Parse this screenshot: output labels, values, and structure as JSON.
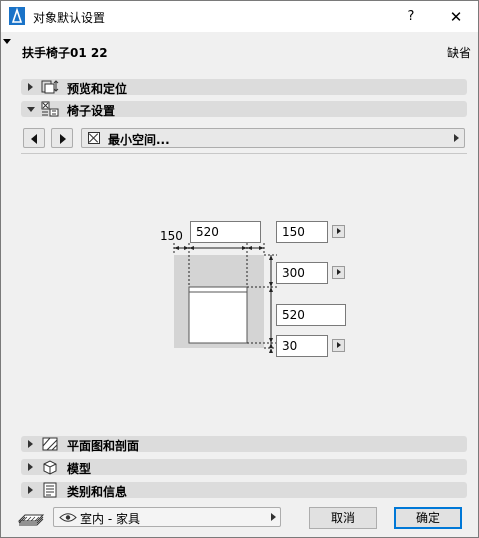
{
  "window": {
    "title": "对象默认设置",
    "help_label": "?",
    "close_label": "✕"
  },
  "header": {
    "object_name": "扶手椅子01 22",
    "default_label": "缺省"
  },
  "sections": {
    "preview": "预览和定位",
    "chair_settings": "椅子设置",
    "floor_plan": "平面图和剖面",
    "model": "模型",
    "classification": "类别和信息"
  },
  "page_nav": {
    "current_page": "最小空间..."
  },
  "dimensions": {
    "left_margin_label": "150",
    "width_value": "520",
    "right_margin_value": "150",
    "front_depth_value": "300",
    "seat_depth_value": "520",
    "back_depth_value": "30"
  },
  "footer": {
    "layer_value": "室内 - 家具",
    "cancel_label": "取消",
    "ok_label": "确定"
  },
  "colors": {
    "accent": "#0078d7",
    "section_bg": "#dcdcdc",
    "window_bg": "#f0f0f0"
  }
}
